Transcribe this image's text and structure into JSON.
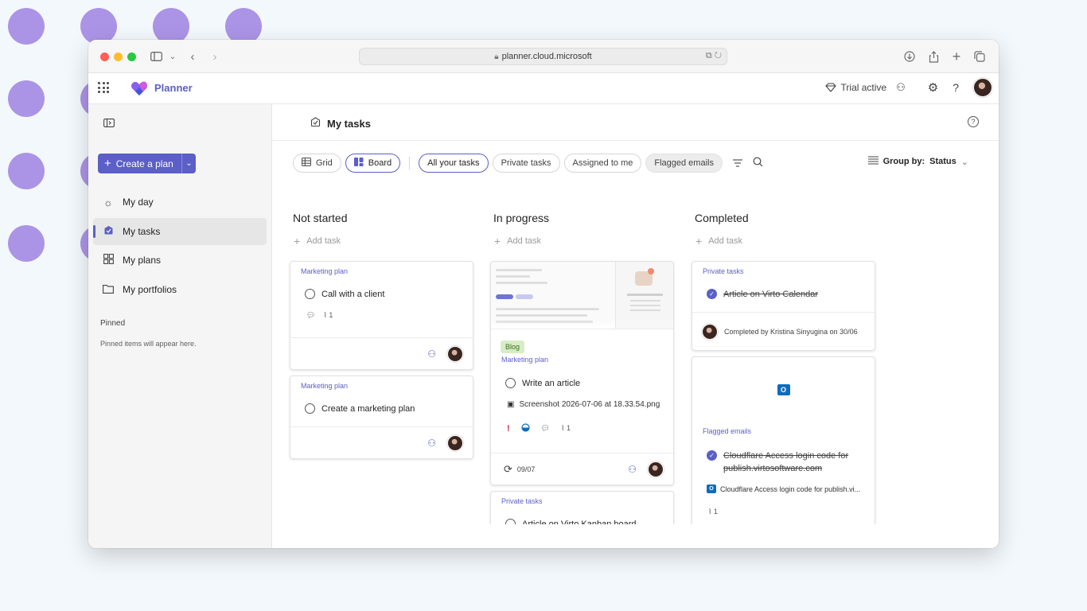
{
  "browser": {
    "url": "planner.cloud.microsoft"
  },
  "app": {
    "name": "Planner",
    "trial_label": "Trial active"
  },
  "sidebar": {
    "create_plan_label": "Create a plan",
    "items": [
      {
        "label": "My day",
        "icon": "sun-icon"
      },
      {
        "label": "My tasks",
        "icon": "my-tasks-icon"
      },
      {
        "label": "My plans",
        "icon": "grid-icon"
      },
      {
        "label": "My portfolios",
        "icon": "folder-icon"
      }
    ],
    "pinned_heading": "Pinned",
    "pinned_empty": "Pinned items will appear here."
  },
  "page": {
    "title": "My tasks"
  },
  "toolbar": {
    "views": [
      "Grid",
      "Board"
    ],
    "filters": [
      "All your tasks",
      "Private tasks",
      "Assigned to me",
      "Flagged emails"
    ],
    "group_by_label": "Group by:",
    "group_by_value": "Status"
  },
  "columns": [
    {
      "title": "Not started",
      "add_task": "Add task",
      "cards": [
        {
          "plan": "Marketing plan",
          "task": "Call with a client",
          "attachments": "1"
        },
        {
          "plan": "Marketing plan",
          "task": "Create a marketing plan"
        }
      ]
    },
    {
      "title": "In progress",
      "add_task": "Add task",
      "cards": [
        {
          "label": "Blog",
          "plan": "Marketing plan",
          "task": "Write an article",
          "attachment_name": "Screenshot 2026-07-06 at 18.33.54.png",
          "attachments": "1",
          "due": "09/07"
        },
        {
          "plan": "Private tasks",
          "task": "Article on Virto Kanban board"
        }
      ]
    },
    {
      "title": "Completed",
      "add_task": "Add task",
      "cards": [
        {
          "plan": "Private tasks",
          "task": "Article on Virto Calendar",
          "completed_by": "Completed by Kristina Sinyugina on 30/06"
        },
        {
          "plan": "Flagged emails",
          "task": "Cloudflare Access login code for publish.virtosoftware.com",
          "email_link": "Cloudflare Access login code for publish.vi...",
          "attachments": "1"
        }
      ]
    }
  ],
  "colors": {
    "accent": "#5b5fc7",
    "blog_label_bg": "#d7ecc6",
    "decor_dots": "#ab94e6"
  }
}
